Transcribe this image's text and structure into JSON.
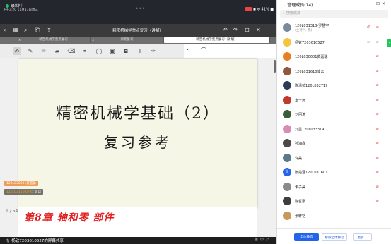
{
  "screen_share": {
    "status": {
      "recording": "录制中",
      "time_date": "下午3:20  11月13日周三",
      "sys_icons": "◉ ⊕ 41% ■"
    },
    "toolbar": {
      "doc_title": "精密机械学重点复习（讲解）",
      "page_dots": "•••"
    },
    "tabs": [
      "精密机械学重点复习",
      "周期复习",
      "精密机械学重点复习（讲解）"
    ],
    "slide": {
      "title": "精密机械学基础（2）",
      "subtitle": "复习参考"
    },
    "next_page_handwriting": "第8章 轴和零 部件",
    "page_indicator": "1 / 54",
    "overlays": {
      "chat1": "120L030601黄嘉聪",
      "chat2_name": "120L031610凌云",
      "chat2_msg": "可以"
    },
    "share_notice": "杨钦7203610527的屏幕共享"
  },
  "members_panel": {
    "title": "管理成员(14)",
    "search_placeholder": "搜索成员",
    "members": [
      {
        "name": "120L031313-罗慧宇",
        "role": "(主持人, 我)",
        "avatar_color": "#7b8a9a",
        "avatar_text": "",
        "video_red": true,
        "mic": "red"
      },
      {
        "name": "杨钦7203610527",
        "role": "",
        "avatar_color": "#f4c542",
        "avatar_text": "",
        "video_red": false,
        "mic": "gray"
      },
      {
        "name": "120L030601黄嘉聪",
        "role": "",
        "avatar_color": "#e67e22",
        "avatar_text": "",
        "video_red": false,
        "mic": "red"
      },
      {
        "name": "120L031610凌云",
        "role": "",
        "avatar_color": "#8e5a3c",
        "avatar_text": "",
        "video_red": false,
        "mic": "red"
      },
      {
        "name": "陈清茹120L032719",
        "role": "",
        "avatar_color": "#2e3a59",
        "avatar_text": "",
        "video_red": false,
        "mic": "red"
      },
      {
        "name": "李宁远",
        "role": "",
        "avatar_color": "#c0392b",
        "avatar_text": "",
        "video_red": false,
        "mic": "red"
      },
      {
        "name": "刘朋涛",
        "role": "",
        "avatar_color": "#3b5e3a",
        "avatar_text": "",
        "video_red": false,
        "mic": "red"
      },
      {
        "name": "刘昱120L033319",
        "role": "",
        "avatar_color": "#d98cb3",
        "avatar_text": "",
        "video_red": false,
        "mic": "red"
      },
      {
        "name": "孙海鑫",
        "role": "",
        "avatar_color": "#4a4a4a",
        "avatar_text": "",
        "video_red": false,
        "mic": "red"
      },
      {
        "name": "许昊",
        "role": "",
        "avatar_color": "#5a7a8c",
        "avatar_text": "",
        "video_red": false,
        "mic": "red"
      },
      {
        "name": "张楚涵120L031601",
        "role": "",
        "avatar_color": "#2563eb",
        "avatar_text": "张",
        "video_red": false,
        "mic": "red"
      },
      {
        "name": "朱子昊",
        "role": "",
        "avatar_color": "#8a8a8a",
        "avatar_text": "",
        "video_red": false,
        "mic": "red"
      },
      {
        "name": "陈哲豪",
        "role": "",
        "avatar_color": "#3d3d3d",
        "avatar_text": "",
        "video_red": false,
        "mic": "red"
      },
      {
        "name": "张轩铭",
        "role": "",
        "avatar_color": "#c79a5b",
        "avatar_text": "",
        "video_red": false,
        "mic": "none"
      }
    ],
    "buttons": {
      "mute_all": "全体静音",
      "unmute_all": "解除全体静音",
      "more": "更多"
    }
  }
}
